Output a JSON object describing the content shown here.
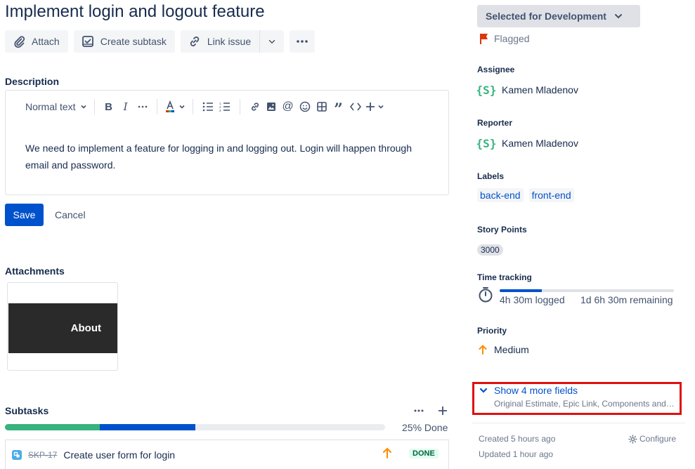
{
  "issue": {
    "title": "Implement login and logout feature"
  },
  "toolbar": {
    "attach": "Attach",
    "create_subtask": "Create subtask",
    "link_issue": "Link issue"
  },
  "description": {
    "label": "Description",
    "text_style": "Normal text",
    "body": "We need to implement a feature for logging in and logging out. Login will happen through email and password.",
    "save": "Save",
    "cancel": "Cancel"
  },
  "attachments": {
    "label": "Attachments",
    "thumb_text": "About"
  },
  "subtasks": {
    "label": "Subtasks",
    "percent_done": "25% Done",
    "done_fraction": 0.25,
    "in_progress_fraction": 0.25,
    "items": [
      {
        "key": "SKP-17",
        "name": "Create user form for login",
        "status": "DONE"
      }
    ]
  },
  "sidebar": {
    "status": "Selected for Development",
    "flagged": "Flagged",
    "assignee_label": "Assignee",
    "assignee": "Kamen Mladenov",
    "reporter_label": "Reporter",
    "reporter": "Kamen Mladenov",
    "labels_label": "Labels",
    "labels": [
      "back-end",
      "front-end"
    ],
    "story_points_label": "Story Points",
    "story_points": "3000",
    "time_tracking_label": "Time tracking",
    "logged": "4h 30m logged",
    "remaining": "1d 6h 30m remaining",
    "logged_fraction": 0.24,
    "priority_label": "Priority",
    "priority": "Medium",
    "show_more": "Show 4 more fields",
    "show_more_sub": "Original Estimate, Epic Link, Components and…",
    "created": "Created 5 hours ago",
    "updated": "Updated 1 hour ago",
    "configure": "Configure"
  },
  "colors": {
    "accent": "#0052cc",
    "done_green": "#36b37e",
    "flag_red": "#de350b",
    "priority_orange": "#ff8b00",
    "highlight_red": "#e01010"
  }
}
